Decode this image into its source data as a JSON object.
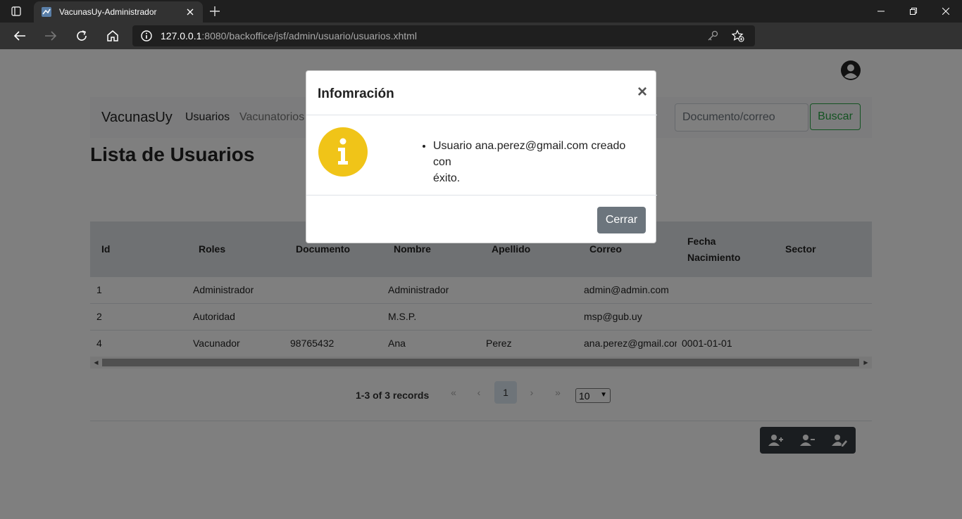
{
  "browser": {
    "tab_title": "VacunasUy-Administrador",
    "url_host": "127.0.0.1",
    "url_rest": ":8080/backoffice/jsf/admin/usuario/usuarios.xhtml"
  },
  "navbar": {
    "brand": "VacunasUy",
    "links": [
      "Usuarios",
      "Vacunatorios"
    ],
    "search_placeholder": "Documento/correo",
    "search_button": "Buscar"
  },
  "page": {
    "title": "Lista de Usuarios"
  },
  "table": {
    "columns": [
      "Id",
      "Roles",
      "Documento",
      "Nombre",
      "Apellido",
      "Correo",
      "Fecha",
      "Nacimiento",
      "Sector"
    ],
    "rows": [
      [
        "1",
        "Administrador",
        "",
        "Administrador",
        "",
        "admin@admin.com",
        "",
        ""
      ],
      [
        "2",
        "Autoridad",
        "",
        "M.S.P.",
        "",
        "msp@gub.uy",
        "",
        ""
      ],
      [
        "4",
        "Vacunador",
        "98765432",
        "Ana",
        "Perez",
        "ana.perez@gmail.com",
        "0001-01-01",
        ""
      ]
    ]
  },
  "pager": {
    "records": "1-3 of 3 records",
    "first": "«",
    "prev": "‹",
    "current": "1",
    "next": "›",
    "last": "»",
    "page_size": "10"
  },
  "modal": {
    "title": "Infomración",
    "close": "×",
    "message_line1": "Usuario ana.perez@gmail.com creado con",
    "message_line2": "éxito.",
    "button": "Cerrar"
  },
  "colors": {
    "info_yellow": "#f0c418",
    "success_green": "#28a745",
    "secondary_gray": "#6c757d"
  }
}
